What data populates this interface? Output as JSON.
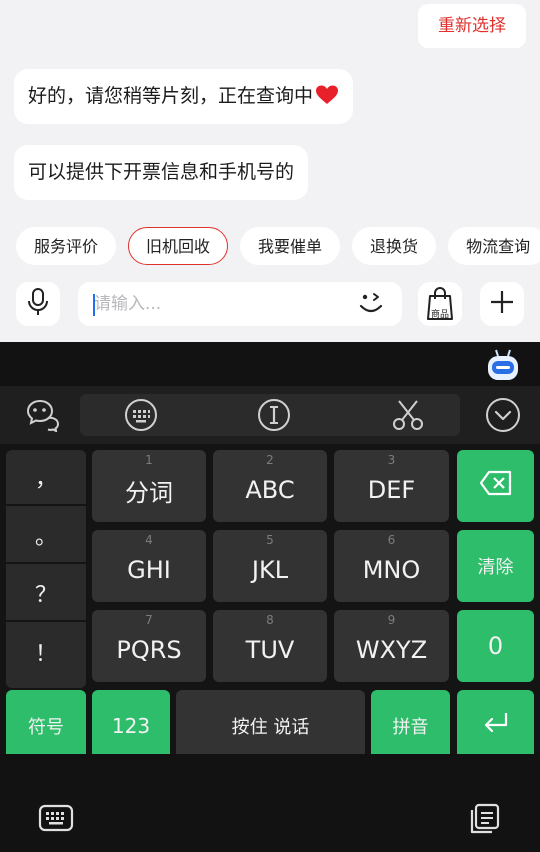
{
  "chat": {
    "reselect_label": "重新选择",
    "message1": "好的，请您稍等片刻，正在查询中",
    "message2": "可以提供下开票信息和手机号的"
  },
  "chips": [
    {
      "label": "服务评价",
      "active": false
    },
    {
      "label": "旧机回收",
      "active": true
    },
    {
      "label": "我要催单",
      "active": false
    },
    {
      "label": "退换货",
      "active": false
    },
    {
      "label": "物流查询",
      "active": false
    }
  ],
  "input": {
    "placeholder": "请输入...",
    "goods_label": "商品"
  },
  "keyboard": {
    "punctuation": [
      "，",
      "。",
      "？",
      "！"
    ],
    "keys": [
      {
        "num": "1",
        "label": "分词"
      },
      {
        "num": "2",
        "label": "ABC"
      },
      {
        "num": "3",
        "label": "DEF"
      },
      {
        "num": "4",
        "label": "GHI"
      },
      {
        "num": "5",
        "label": "JKL"
      },
      {
        "num": "6",
        "label": "MNO"
      },
      {
        "num": "7",
        "label": "PQRS"
      },
      {
        "num": "8",
        "label": "TUV"
      },
      {
        "num": "9",
        "label": "WXYZ"
      }
    ],
    "clear_label": "清除",
    "zero_label": "0",
    "symbols_label": "符号",
    "num_label": "123",
    "voice_label": "按住 说话",
    "pinyin_label": "拼音"
  },
  "colors": {
    "accent_red": "#e0312e",
    "keyboard_green": "#2ebd6b",
    "heart": "#e8202a"
  },
  "icons": [
    "microphone-icon",
    "emoji-wink-icon",
    "shopping-bag-icon",
    "plus-icon",
    "robot-icon",
    "chat-bubbles-icon",
    "keyboard-grid-icon",
    "text-cursor-icon",
    "scissors-icon",
    "chevron-down-icon",
    "backspace-icon",
    "enter-icon",
    "keyboard-icon",
    "clipboard-icon"
  ]
}
